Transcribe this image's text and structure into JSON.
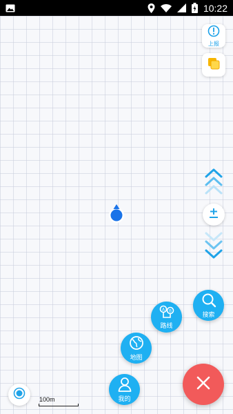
{
  "status_bar": {
    "time": "10:22",
    "icons": [
      "image-icon",
      "location-icon",
      "wifi-icon",
      "signal-icon",
      "battery-icon"
    ]
  },
  "map": {
    "scale_label": "100m",
    "background_color": "#f7f8fb"
  },
  "controls": {
    "report_label": "上报",
    "layers_icon": "layers-icon",
    "zoom_icon": "zoom-icon",
    "locate_icon": "locate-icon"
  },
  "radial_menu": {
    "items": [
      {
        "label": "搜索",
        "icon": "search-icon"
      },
      {
        "label": "路线",
        "icon": "route-icon"
      },
      {
        "label": "地图",
        "icon": "globe-icon"
      },
      {
        "label": "我的",
        "icon": "user-icon"
      }
    ],
    "close_icon": "close-icon"
  },
  "colors": {
    "accent": "#1fb0f2",
    "close": "#f25a5a",
    "marker": "#1a73e8",
    "status_bar": "#000000"
  }
}
